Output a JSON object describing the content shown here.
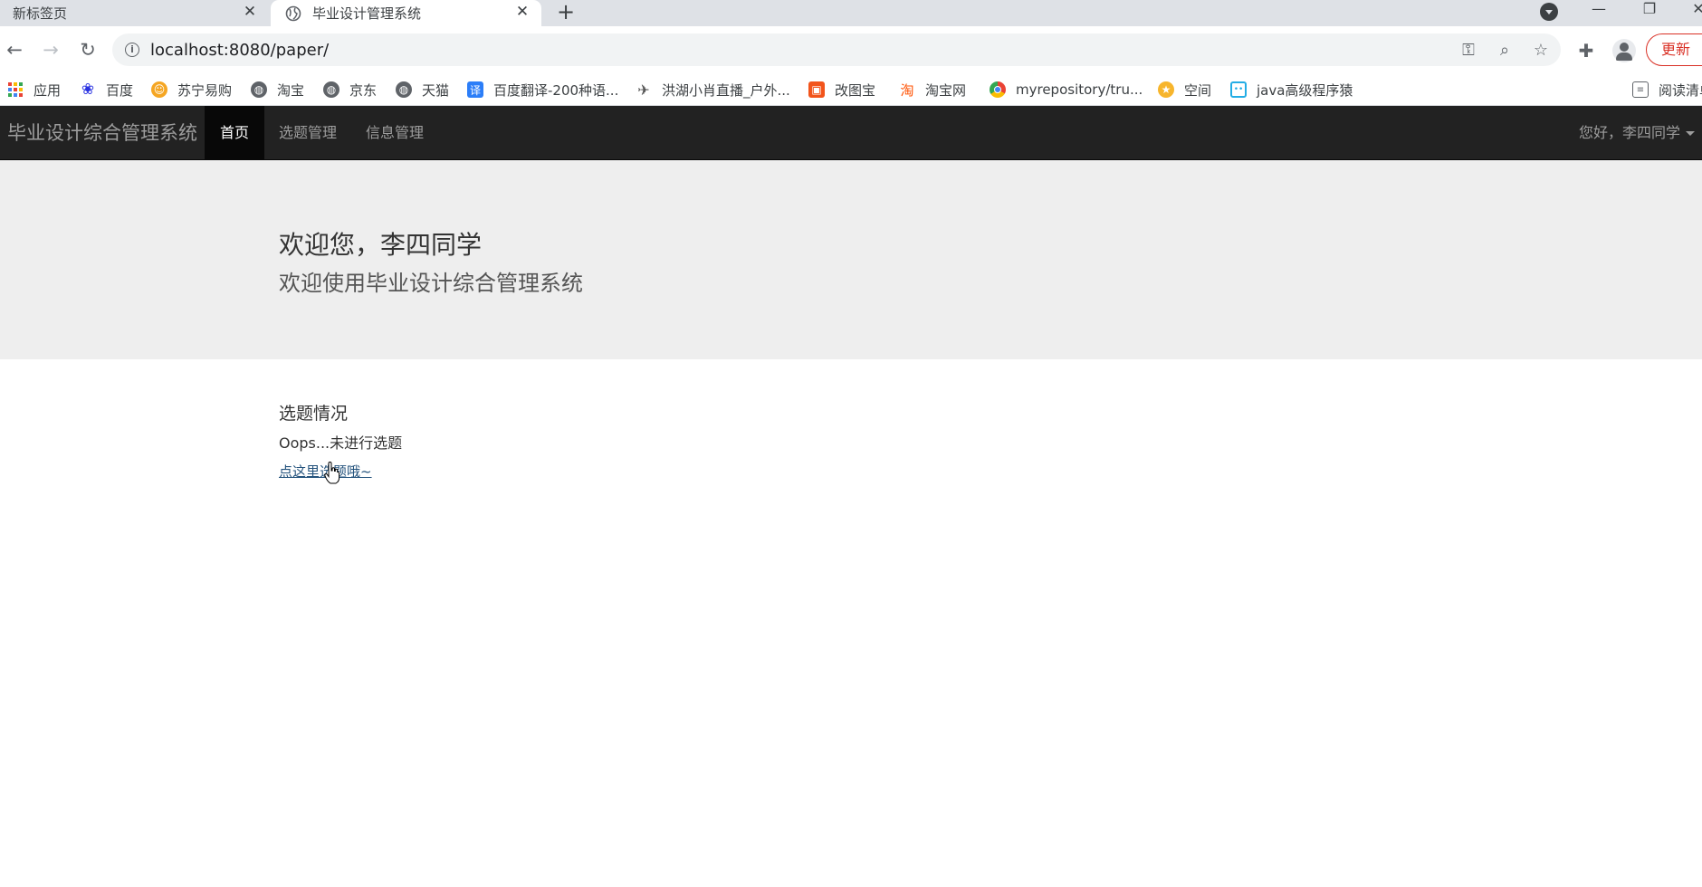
{
  "browser": {
    "tabs": [
      {
        "title": "新标签页",
        "active": false
      },
      {
        "title": "毕业设计管理系统",
        "active": true
      }
    ],
    "url": "localhost:8080/paper/",
    "update_label": "更新",
    "bookmarks": [
      {
        "label": "应用",
        "icon": "apps-grid-icon"
      },
      {
        "label": "百度",
        "icon": "baidu-paw-icon"
      },
      {
        "label": "苏宁易购",
        "icon": "suning-icon"
      },
      {
        "label": "淘宝",
        "icon": "globe-icon"
      },
      {
        "label": "京东",
        "icon": "globe-icon"
      },
      {
        "label": "天猫",
        "icon": "globe-icon"
      },
      {
        "label": "百度翻译-200种语...",
        "icon": "translate-icon"
      },
      {
        "label": "洪湖小肖直播_户外...",
        "icon": "bird-icon"
      },
      {
        "label": "改图宝",
        "icon": "image-edit-icon"
      },
      {
        "label": "淘宝网",
        "icon": "taobao-icon"
      },
      {
        "label": "myrepository/tru...",
        "icon": "chrome-icon"
      },
      {
        "label": "空间",
        "icon": "qzone-icon"
      },
      {
        "label": "java高级程序猿",
        "icon": "bilibili-icon"
      },
      {
        "label": "阅读清单",
        "icon": "reading-list-icon"
      }
    ]
  },
  "navbar": {
    "brand": "毕业设计综合管理系统",
    "items": [
      {
        "label": "首页",
        "active": true
      },
      {
        "label": "选题管理",
        "active": false
      },
      {
        "label": "信息管理",
        "active": false
      }
    ],
    "user_greeting": "您好，李四同学"
  },
  "jumbotron": {
    "title": "欢迎您，李四同学",
    "subtitle": "欢迎使用毕业设计综合管理系统"
  },
  "topic_status": {
    "heading": "选题情况",
    "message": "Oops...未进行选题",
    "link_text": "点这里选题哦~"
  },
  "colors": {
    "navbar_bg": "#222222",
    "jumbotron_bg": "#eeeeee",
    "link": "#23527c",
    "update_red": "#d93025"
  }
}
